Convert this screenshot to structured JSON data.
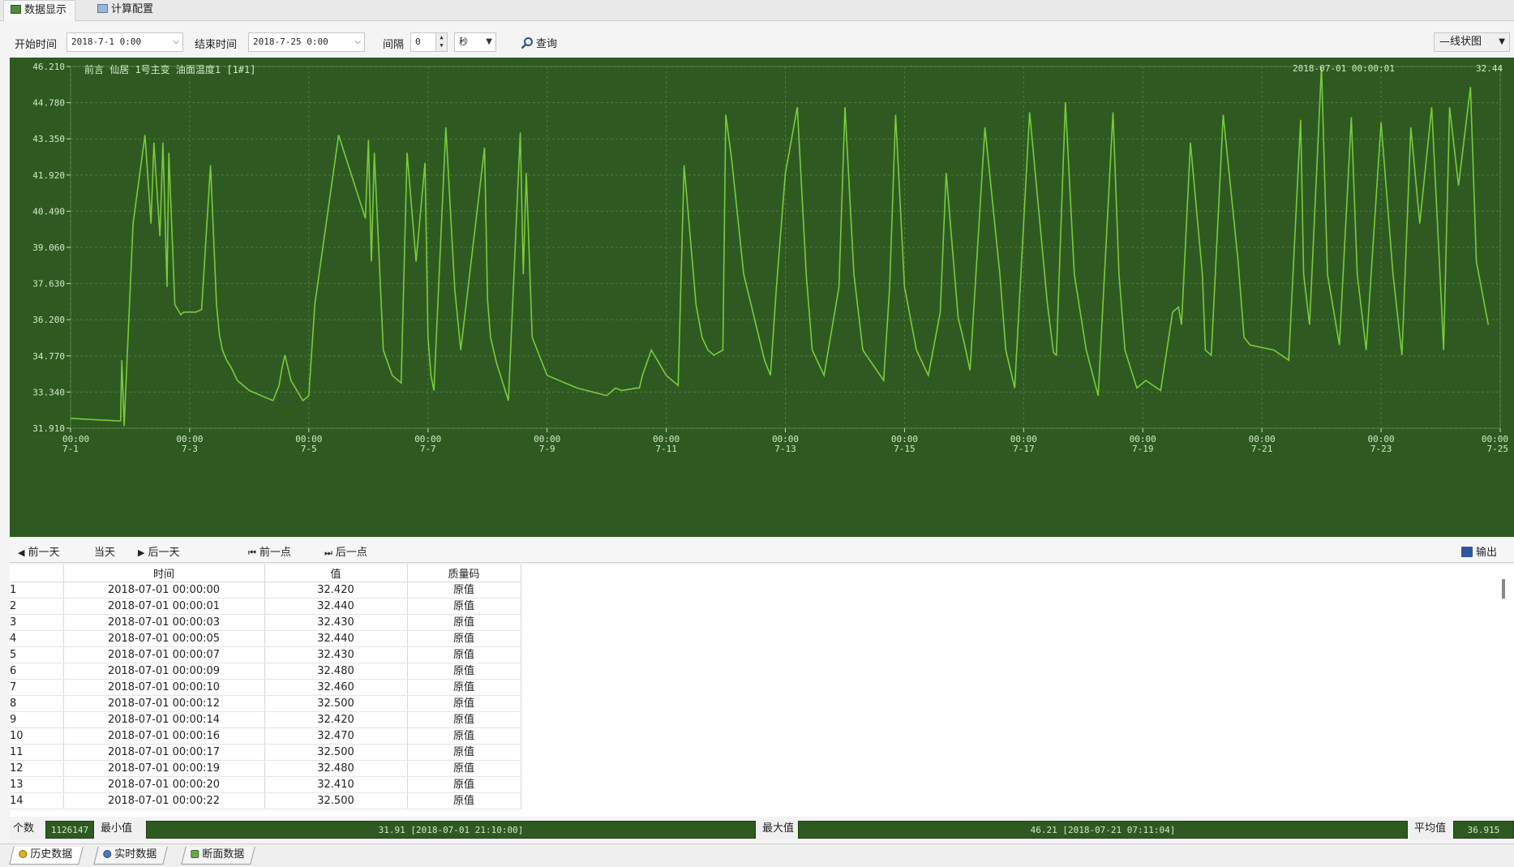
{
  "top_tabs": [
    {
      "label": "数据显示",
      "icon": "grid-icon",
      "active": true
    },
    {
      "label": "计算配置",
      "icon": "config-icon",
      "active": false
    }
  ],
  "toolbar": {
    "start_label": "开始时间",
    "start_value": "2018-7-1 0:00",
    "end_label": "结束时间",
    "end_value": "2018-7-25 0:00",
    "interval_label": "间隔",
    "interval_value": "0",
    "interval_unit": "秒",
    "query_label": "查询",
    "chart_mode_label": "—线状图"
  },
  "chart": {
    "series_label": "前言 仙居 1号主变 油面温度1 [1#1]",
    "cursor_time": "2018-07-01 00:00:01",
    "cursor_value": "32.44",
    "line_color": "#7acb3c",
    "background_color": "#2e5a22"
  },
  "chart_data": {
    "type": "line",
    "title": "",
    "xlabel": "",
    "ylabel": "",
    "ylim": [
      31.91,
      46.21
    ],
    "xlim_days": [
      0,
      24
    ],
    "ytick_labels": [
      "31.910",
      "33.340",
      "34.770",
      "36.200",
      "37.630",
      "39.060",
      "40.490",
      "41.920",
      "43.350",
      "44.780",
      "46.210"
    ],
    "xtick_labels": [
      [
        "00:00",
        "7-1"
      ],
      [
        "00:00",
        "7-3"
      ],
      [
        "00:00",
        "7-5"
      ],
      [
        "00:00",
        "7-7"
      ],
      [
        "00:00",
        "7-9"
      ],
      [
        "00:00",
        "7-11"
      ],
      [
        "00:00",
        "7-13"
      ],
      [
        "00:00",
        "7-15"
      ],
      [
        "00:00",
        "7-17"
      ],
      [
        "00:00",
        "7-19"
      ],
      [
        "00:00",
        "7-21"
      ],
      [
        "00:00",
        "7-23"
      ],
      [
        "00:00",
        "7-25"
      ]
    ],
    "x_days": [
      0,
      0.8,
      0.84,
      0.86,
      0.9,
      1.05,
      1.25,
      1.35,
      1.4,
      1.5,
      1.55,
      1.62,
      1.65,
      1.75,
      1.85,
      1.9,
      2.0,
      2.1,
      2.2,
      2.35,
      2.45,
      2.5,
      2.55,
      2.62,
      2.7,
      2.8,
      3.0,
      3.4,
      3.5,
      3.55,
      3.6,
      3.7,
      3.9,
      4.0,
      4.1,
      4.5,
      4.95,
      5.0,
      5.05,
      5.1,
      5.25,
      5.4,
      5.55,
      5.65,
      5.8,
      5.95,
      6.0,
      6.05,
      6.1,
      6.3,
      6.45,
      6.55,
      6.95,
      7.0,
      7.05,
      7.15,
      7.35,
      7.55,
      7.6,
      7.65,
      7.75,
      8.0,
      8.5,
      9.0,
      9.05,
      9.15,
      9.25,
      9.5,
      9.55,
      9.6,
      9.75,
      10.0,
      10.2,
      10.3,
      10.5,
      10.6,
      10.7,
      10.8,
      10.95,
      11.0,
      11.1,
      11.3,
      11.65,
      11.75,
      11.85,
      12.0,
      12.2,
      12.35,
      12.45,
      12.65,
      12.9,
      13.0,
      13.15,
      13.3,
      13.65,
      13.75,
      13.85,
      14.0,
      14.2,
      14.4,
      14.6,
      14.7,
      14.9,
      15.0,
      15.1,
      15.35,
      15.6,
      15.7,
      15.85,
      16.1,
      16.4,
      16.5,
      16.55,
      16.7,
      16.85,
      17.05,
      17.25,
      17.5,
      17.6,
      17.7,
      17.9,
      18.05,
      18.3,
      18.5,
      18.6,
      18.65,
      18.8,
      19.0,
      19.05,
      19.15,
      19.35,
      19.6,
      19.7,
      19.8,
      20.0,
      20.2,
      20.45,
      20.65,
      20.7,
      20.8,
      21.0,
      21.1,
      21.3,
      21.5,
      21.6,
      21.75,
      22.0,
      22.2,
      22.35,
      22.5,
      22.65,
      22.85,
      23.0,
      23.05,
      23.15,
      23.3,
      23.5,
      23.6,
      23.8,
      24.0
    ],
    "values": [
      32.3,
      32.2,
      32.2,
      34.6,
      32.0,
      40.0,
      43.5,
      40.0,
      43.2,
      39.5,
      43.2,
      37.5,
      42.8,
      36.8,
      36.4,
      36.5,
      36.5,
      36.5,
      36.6,
      42.3,
      36.8,
      35.6,
      35.0,
      34.6,
      34.3,
      33.8,
      33.4,
      33.0,
      33.6,
      34.3,
      34.8,
      33.8,
      33.0,
      33.2,
      36.8,
      43.5,
      40.2,
      43.3,
      38.5,
      42.8,
      35.0,
      34.0,
      33.7,
      42.8,
      38.5,
      42.4,
      35.5,
      34.0,
      33.4,
      43.8,
      37.4,
      35.0,
      43.0,
      37.0,
      35.5,
      34.5,
      33.0,
      43.6,
      38.0,
      42.0,
      35.5,
      34.0,
      33.5,
      33.2,
      33.3,
      33.5,
      33.4,
      33.5,
      33.5,
      34.0,
      35.0,
      34.0,
      33.6,
      42.3,
      36.8,
      35.5,
      35.0,
      34.8,
      35.0,
      44.3,
      42.5,
      38.0,
      34.6,
      34.0,
      37.5,
      42.0,
      44.6,
      38.0,
      35.0,
      34.0,
      37.5,
      44.6,
      38.0,
      35.0,
      33.8,
      37.5,
      44.3,
      37.5,
      35.0,
      34.0,
      36.5,
      42.0,
      36.3,
      35.3,
      34.2,
      43.8,
      38.0,
      35.0,
      33.5,
      44.4,
      36.8,
      34.9,
      34.8,
      44.8,
      38.0,
      35.0,
      33.2,
      44.4,
      38.0,
      35.0,
      33.5,
      33.8,
      33.4,
      36.5,
      36.7,
      36.0,
      43.2,
      38.0,
      35.0,
      34.8,
      44.3,
      38.5,
      35.5,
      35.2,
      35.1,
      35.0,
      34.6,
      44.1,
      38.0,
      36.0,
      46.2,
      38.0,
      35.2,
      44.2,
      38.0,
      35.0,
      44.0,
      38.0,
      34.8,
      43.8,
      40.0,
      44.6,
      37.5,
      35.0,
      44.6,
      41.5,
      45.4,
      38.5,
      36.0
    ],
    "grid": true,
    "legend": "none"
  },
  "nav": {
    "prev_day": "前一天",
    "today": "当天",
    "next_day": "后一天",
    "prev_point": "前一点",
    "next_point": "后一点",
    "export": "输出"
  },
  "table": {
    "headers": [
      "",
      "时间",
      "值",
      "质量码"
    ],
    "rows": [
      [
        "1",
        "2018-07-01 00:00:00",
        "32.420",
        "原值"
      ],
      [
        "2",
        "2018-07-01 00:00:01",
        "32.440",
        "原值"
      ],
      [
        "3",
        "2018-07-01 00:00:03",
        "32.430",
        "原值"
      ],
      [
        "4",
        "2018-07-01 00:00:05",
        "32.440",
        "原值"
      ],
      [
        "5",
        "2018-07-01 00:00:07",
        "32.430",
        "原值"
      ],
      [
        "6",
        "2018-07-01 00:00:09",
        "32.480",
        "原值"
      ],
      [
        "7",
        "2018-07-01 00:00:10",
        "32.460",
        "原值"
      ],
      [
        "8",
        "2018-07-01 00:00:12",
        "32.500",
        "原值"
      ],
      [
        "9",
        "2018-07-01 00:00:14",
        "32.420",
        "原值"
      ],
      [
        "10",
        "2018-07-01 00:00:16",
        "32.470",
        "原值"
      ],
      [
        "11",
        "2018-07-01 00:00:17",
        "32.500",
        "原值"
      ],
      [
        "12",
        "2018-07-01 00:00:19",
        "32.480",
        "原值"
      ],
      [
        "13",
        "2018-07-01 00:00:20",
        "32.410",
        "原值"
      ],
      [
        "14",
        "2018-07-01 00:00:22",
        "32.500",
        "原值"
      ]
    ]
  },
  "stats": {
    "count_label": "个数",
    "count_value": "1126147",
    "min_label": "最小值",
    "min_value": "31.91 [2018-07-01 21:10:00]",
    "max_label": "最大值",
    "max_value": "46.21 [2018-07-21 07:11:04]",
    "avg_label": "平均值",
    "avg_value": "36.915"
  },
  "bottom_tabs": [
    {
      "label": "历史数据",
      "icon": "history-icon",
      "active": true
    },
    {
      "label": "实时数据",
      "icon": "realtime-icon",
      "active": false
    },
    {
      "label": "断面数据",
      "icon": "section-icon",
      "active": false
    }
  ]
}
